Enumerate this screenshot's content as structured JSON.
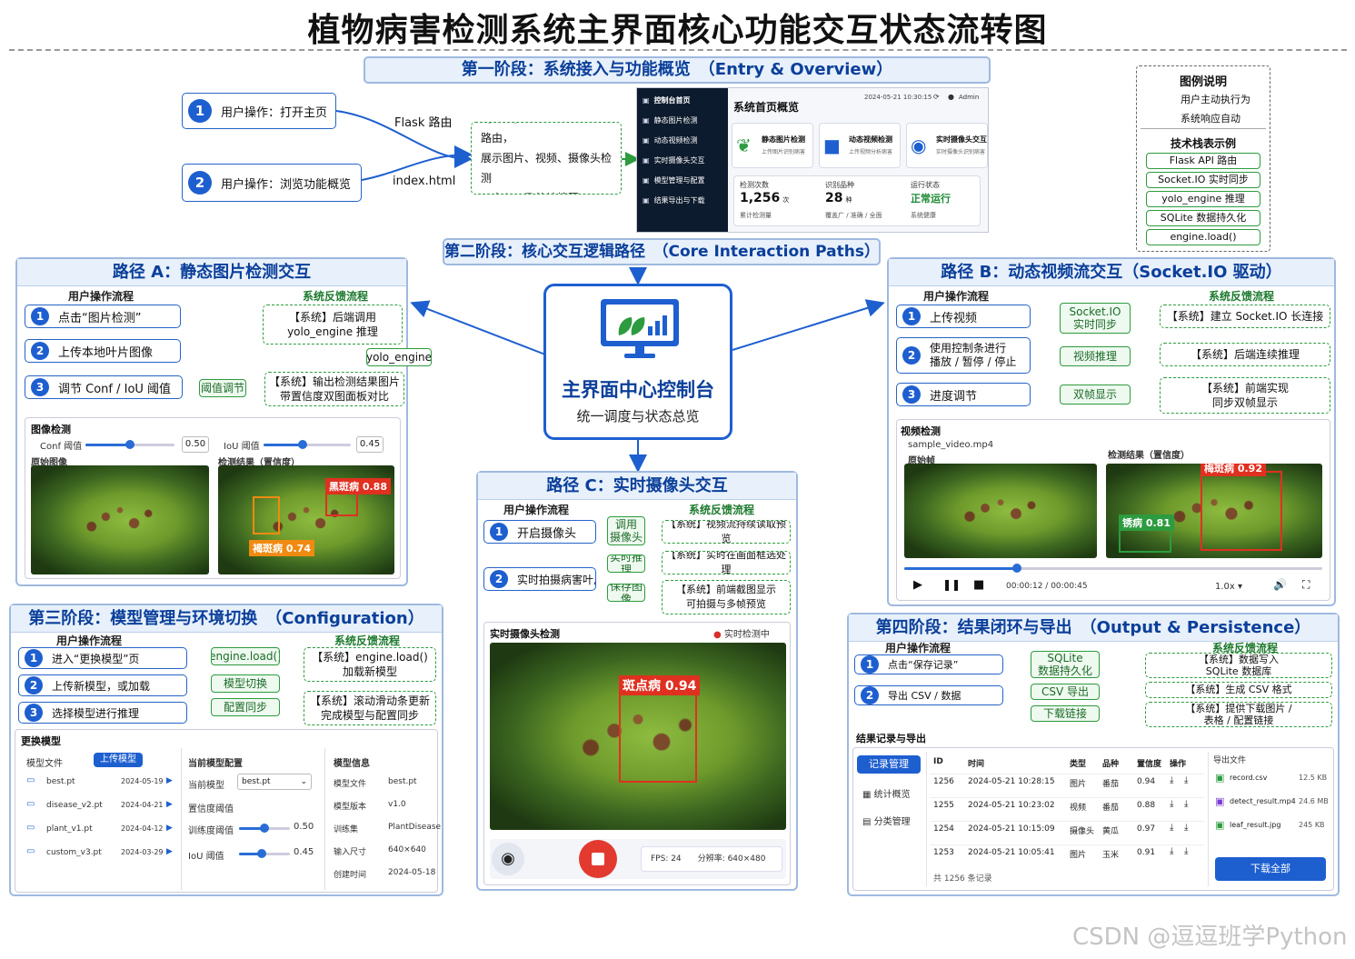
{
  "title": "植物病害检测系统主界面核心功能交互状态流转图",
  "phase1": {
    "title": "第一阶段：系统接入与功能概览　（Entry & Overview）",
    "step1": "用户操作：打开主页",
    "step2": "用户操作：浏览功能概览",
    "arrow1": "Flask 路由",
    "arrow2": "index.html",
    "sys": "【系统】加载 index.html 路由，\n展示图片、视频、摄像头检测\n三大入口及统计摘要",
    "mock": {
      "nav": [
        "控制台首页",
        "静态图片检测",
        "动态视频检测",
        "实时摄像头交互",
        "模型管理与配置",
        "结果导出与下载"
      ],
      "header": "系统首页概览",
      "datetime": "2024-05-21 10:30:15",
      "user": "Admin",
      "cards": [
        {
          "t": "静态图片检测",
          "s": "上传图片识别病害"
        },
        {
          "t": "动态视频检测",
          "s": "上传视频分析病害"
        },
        {
          "t": "实时摄像头交互",
          "s": "实时摄像头识别病害"
        }
      ],
      "stats": [
        {
          "l": "检测次数",
          "v": "1,256",
          "u": "次",
          "s": "累计检测量"
        },
        {
          "l": "识别品种",
          "v": "28",
          "u": "种",
          "s": "覆盖广 / 准确 / 全面"
        },
        {
          "l": "运行状态",
          "v": "正常运行",
          "u": "",
          "s": "系统健康"
        }
      ]
    }
  },
  "legend": {
    "title": "图例说明",
    "user": "用户主动执行为",
    "sys": "系统响应自动",
    "stack_title": "技术栈表示例",
    "stack": [
      "Flask API 路由",
      "Socket.IO 实时同步",
      "yolo_engine 推理",
      "SQLite 数据持久化",
      "engine.load()"
    ]
  },
  "phase2": {
    "title": "第二阶段：核心交互逻辑路径　（Core Interaction Paths）"
  },
  "center": {
    "title": "主界面中心控制台",
    "sub": "统一调度与状态总览"
  },
  "pathA": {
    "title": "路径 A：静态图片检测交互",
    "user_col": "用户操作流程",
    "sys_col": "系统反馈流程",
    "steps": [
      "点击“图片检测”",
      "上传本地叶片图像",
      "调节 Conf / IoU 阈值"
    ],
    "sys1": "【系统】后端调用\nyolo_engine 推理",
    "tag1": "yolo_engine",
    "tag2": "阈值调节",
    "sys2": "【系统】输出检测结果图片\n带置信度双图面板对比",
    "panel": {
      "title": "图像检测",
      "conf": "Conf 阈值",
      "conf_v": "0.50",
      "conf_n": 0.5,
      "iou": "IoU 阈值",
      "iou_v": "0.45",
      "iou_n": 0.45,
      "orig": "原始图像",
      "res": "检测结果（置信度）",
      "det1": "黑斑病 0.88",
      "det2": "褐斑病 0.74"
    }
  },
  "pathB": {
    "title": "路径 B：动态视频流交互（Socket.IO 驱动）",
    "user_col": "用户操作流程",
    "sys_col": "系统反馈流程",
    "steps": [
      "上传视频",
      "使用控制条进行\n播放 / 暂停 / 停止",
      "进度调节"
    ],
    "tags": [
      "Socket.IO\n实时同步",
      "视频推理",
      "双帧显示"
    ],
    "sys": [
      "【系统】建立 Socket.IO 长连接",
      "【系统】后端连续推理",
      "【系统】前端实现\n同步双帧显示"
    ],
    "panel": {
      "title": "视频检测",
      "file": "sample_video.mp4",
      "orig": "原始帧",
      "res": "检测结果（置信度）",
      "det1": "梅斑病 0.92",
      "det2": "锈病 0.81",
      "time": "00:00:12",
      "dur": "00:00:45",
      "speed": "1.0x",
      "progress": 0.27
    }
  },
  "pathC": {
    "title": "路径 C：实时摄像头交互",
    "user_col": "用户操作流程",
    "sys_col": "系统反馈流程",
    "steps": [
      "开启摄像头",
      "实时拍摄病害叶片"
    ],
    "tags": [
      "调用\n摄像头",
      "实时推理",
      "保存图像"
    ],
    "sys": [
      "【系统】视频流持续读取预览",
      "【系统】实时在画面框选处理",
      "【系统】前端截图显示\n可拍摄与多帧预览"
    ],
    "panel": {
      "title": "实时摄像头检测",
      "status": "实时检测中",
      "det": "斑点病 0.94",
      "fps": "FPS: 24",
      "res": "分辨率: 640×480"
    }
  },
  "phase3": {
    "title": "第三阶段：模型管理与环境切换　（Configuration）",
    "user_col": "用户操作流程",
    "sys_col": "系统反馈流程",
    "steps": [
      "进入“更换模型”页",
      "上传新模型，或加载",
      "选择模型进行推理"
    ],
    "tags": [
      "engine.load()",
      "模型切换",
      "配置同步"
    ],
    "sys": [
      "【系统】engine.load()\n加载新模型",
      "【系统】滚动滑动条更新\n完成模型与配置同步"
    ],
    "panel": {
      "title": "更换模型",
      "files_h": "模型文件",
      "upload": "上传模型",
      "files": [
        {
          "n": "best.pt",
          "d": "2024-05-19"
        },
        {
          "n": "disease_v2.pt",
          "d": "2024-04-21"
        },
        {
          "n": "plant_v1.pt",
          "d": "2024-04-12"
        },
        {
          "n": "custom_v3.pt",
          "d": "2024-03-29"
        }
      ],
      "cfg_h": "当前模型配置",
      "cur_l": "当前模型",
      "cur_v": "best.pt",
      "conf_l": "置信度阈值",
      "train_l": "训练度阈值",
      "train_v": "0.50",
      "train_n": 0.5,
      "iou_l": "IoU 阈值",
      "iou_v": "0.45",
      "iou_n": 0.45,
      "info_h": "模型信息",
      "info": [
        {
          "k": "模型文件",
          "v": "best.pt"
        },
        {
          "k": "模型版本",
          "v": "v1.0"
        },
        {
          "k": "训练集",
          "v": "PlantDisease"
        },
        {
          "k": "输入尺寸",
          "v": "640×640"
        },
        {
          "k": "创建时间",
          "v": "2024-05-18"
        }
      ]
    }
  },
  "phase4": {
    "title": "第四阶段：结果闭环与导出　（Output & Persistence）",
    "user_col": "用户操作流程",
    "sys_col": "系统反馈流程",
    "steps": [
      "点击“保存记录”",
      "导出 CSV / 数据"
    ],
    "tags": [
      "SQLite\n数据持久化",
      "CSV 导出",
      "下载链接"
    ],
    "sys": [
      "【系统】数据写入\nSQLite 数据库",
      "【系统】生成 CSV 格式",
      "【系统】提供下载图片 /\n表格 / 配置链接"
    ],
    "panel": {
      "title": "结果记录与导出",
      "nav": [
        "记录管理",
        "统计概览",
        "分类管理"
      ],
      "cols": [
        "ID",
        "时间",
        "类型",
        "品种",
        "置信度",
        "操作"
      ],
      "rows": [
        [
          "1256",
          "2024-05-21 10:28:15",
          "图片",
          "番茄",
          "0.94"
        ],
        [
          "1255",
          "2024-05-21 10:23:02",
          "视频",
          "番茄",
          "0.88"
        ],
        [
          "1254",
          "2024-05-21 10:15:09",
          "摄像头",
          "黄瓜",
          "0.97"
        ],
        [
          "1253",
          "2024-05-21 10:05:41",
          "图片",
          "玉米",
          "0.91"
        ]
      ],
      "total": "共 1256 条记录",
      "exp_h": "导出文件",
      "files": [
        {
          "n": "record.csv",
          "s": "12.5 KB"
        },
        {
          "n": "detect_result.mp4",
          "s": "24.6 MB"
        },
        {
          "n": "leaf_result.jpg",
          "s": "245 KB"
        }
      ],
      "download": "下载全部"
    }
  },
  "watermark": "CSDN @逗逗班学Python",
  "colors": {
    "blue": "#1e5fd0",
    "green": "#2d9b3f",
    "dark": "#0d1b2e",
    "red": "#d9302a"
  }
}
